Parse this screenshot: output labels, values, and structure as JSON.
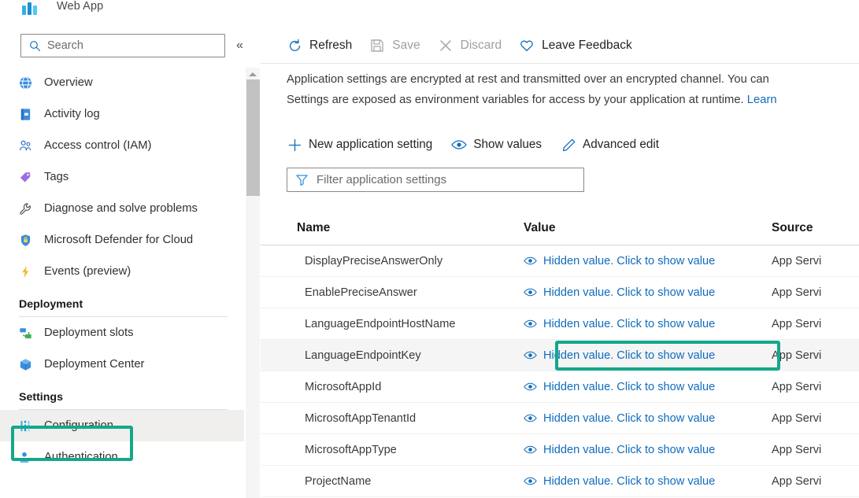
{
  "resource": {
    "title": "Web App",
    "logo_icon": "web-app-icon"
  },
  "sidebar": {
    "search": {
      "placeholder": "Search",
      "icon": "search-icon"
    },
    "collapse_icon": "chevron-double-left-icon",
    "items": [
      {
        "label": "Overview",
        "icon": "overview-icon"
      },
      {
        "label": "Activity log",
        "icon": "activity-log-icon"
      },
      {
        "label": "Access control (IAM)",
        "icon": "access-control-icon"
      },
      {
        "label": "Tags",
        "icon": "tags-icon"
      },
      {
        "label": "Diagnose and solve problems",
        "icon": "wrench-icon"
      },
      {
        "label": "Microsoft Defender for Cloud",
        "icon": "shield-icon"
      },
      {
        "label": "Events (preview)",
        "icon": "lightning-bolt-icon"
      }
    ],
    "groups": [
      {
        "title": "Deployment",
        "items": [
          {
            "label": "Deployment slots",
            "icon": "deployment-slots-icon"
          },
          {
            "label": "Deployment Center",
            "icon": "deployment-center-icon"
          }
        ]
      },
      {
        "title": "Settings",
        "items": [
          {
            "label": "Configuration",
            "icon": "configuration-icon",
            "selected": true
          },
          {
            "label": "Authentication",
            "icon": "authentication-icon"
          }
        ]
      }
    ]
  },
  "toolbar": {
    "refresh_label": "Refresh",
    "refresh_icon": "refresh-icon",
    "save_label": "Save",
    "save_icon": "save-icon",
    "discard_label": "Discard",
    "discard_icon": "close-icon",
    "feedback_label": "Leave Feedback",
    "feedback_icon": "heart-icon"
  },
  "description": {
    "line1": "Application settings are encrypted at rest and transmitted over an encrypted channel. You can",
    "line2_text": "Settings are exposed as environment variables for access by your application at runtime. ",
    "line2_link": "Learn"
  },
  "actions": [
    {
      "label": "New application setting",
      "icon": "plus-icon"
    },
    {
      "label": "Show values",
      "icon": "eye-icon"
    },
    {
      "label": "Advanced edit",
      "icon": "pencil-icon"
    }
  ],
  "filter": {
    "placeholder": "Filter application settings",
    "icon": "filter-icon"
  },
  "table": {
    "columns": [
      "Name",
      "Value",
      "Source"
    ],
    "hidden_value_label": "Hidden value. Click to show value",
    "eye_icon": "eye-icon",
    "source_value": "App Servi",
    "rows": [
      {
        "name": "DisplayPreciseAnswerOnly",
        "value": "Hidden value. Click to show value",
        "source": "App Servi",
        "hover": false
      },
      {
        "name": "EnablePreciseAnswer",
        "value": "Hidden value. Click to show value",
        "source": "App Servi",
        "hover": false
      },
      {
        "name": "LanguageEndpointHostName",
        "value": "Hidden value. Click to show value",
        "source": "App Servi",
        "hover": false
      },
      {
        "name": "LanguageEndpointKey",
        "value": "Hidden value. Click to show value",
        "source": "App Servi",
        "hover": true
      },
      {
        "name": "MicrosoftAppId",
        "value": "Hidden value. Click to show value",
        "source": "App Servi",
        "hover": false
      },
      {
        "name": "MicrosoftAppTenantId",
        "value": "Hidden value. Click to show value",
        "source": "App Servi",
        "hover": false
      },
      {
        "name": "MicrosoftAppType",
        "value": "Hidden value. Click to show value",
        "source": "App Servi",
        "hover": false
      },
      {
        "name": "ProjectName",
        "value": "Hidden value. Click to show value",
        "source": "App Servi",
        "hover": false
      }
    ]
  },
  "annotations": {
    "highlight_color": "#14a88a",
    "highlighted_sidebar_item": "Configuration",
    "highlighted_table_row": "LanguageEndpointKey"
  },
  "colors": {
    "link": "#0f6cbd",
    "highlight": "#14a88a",
    "hover_row": "#f5f5f5",
    "selected_nav": "#f0efee"
  }
}
